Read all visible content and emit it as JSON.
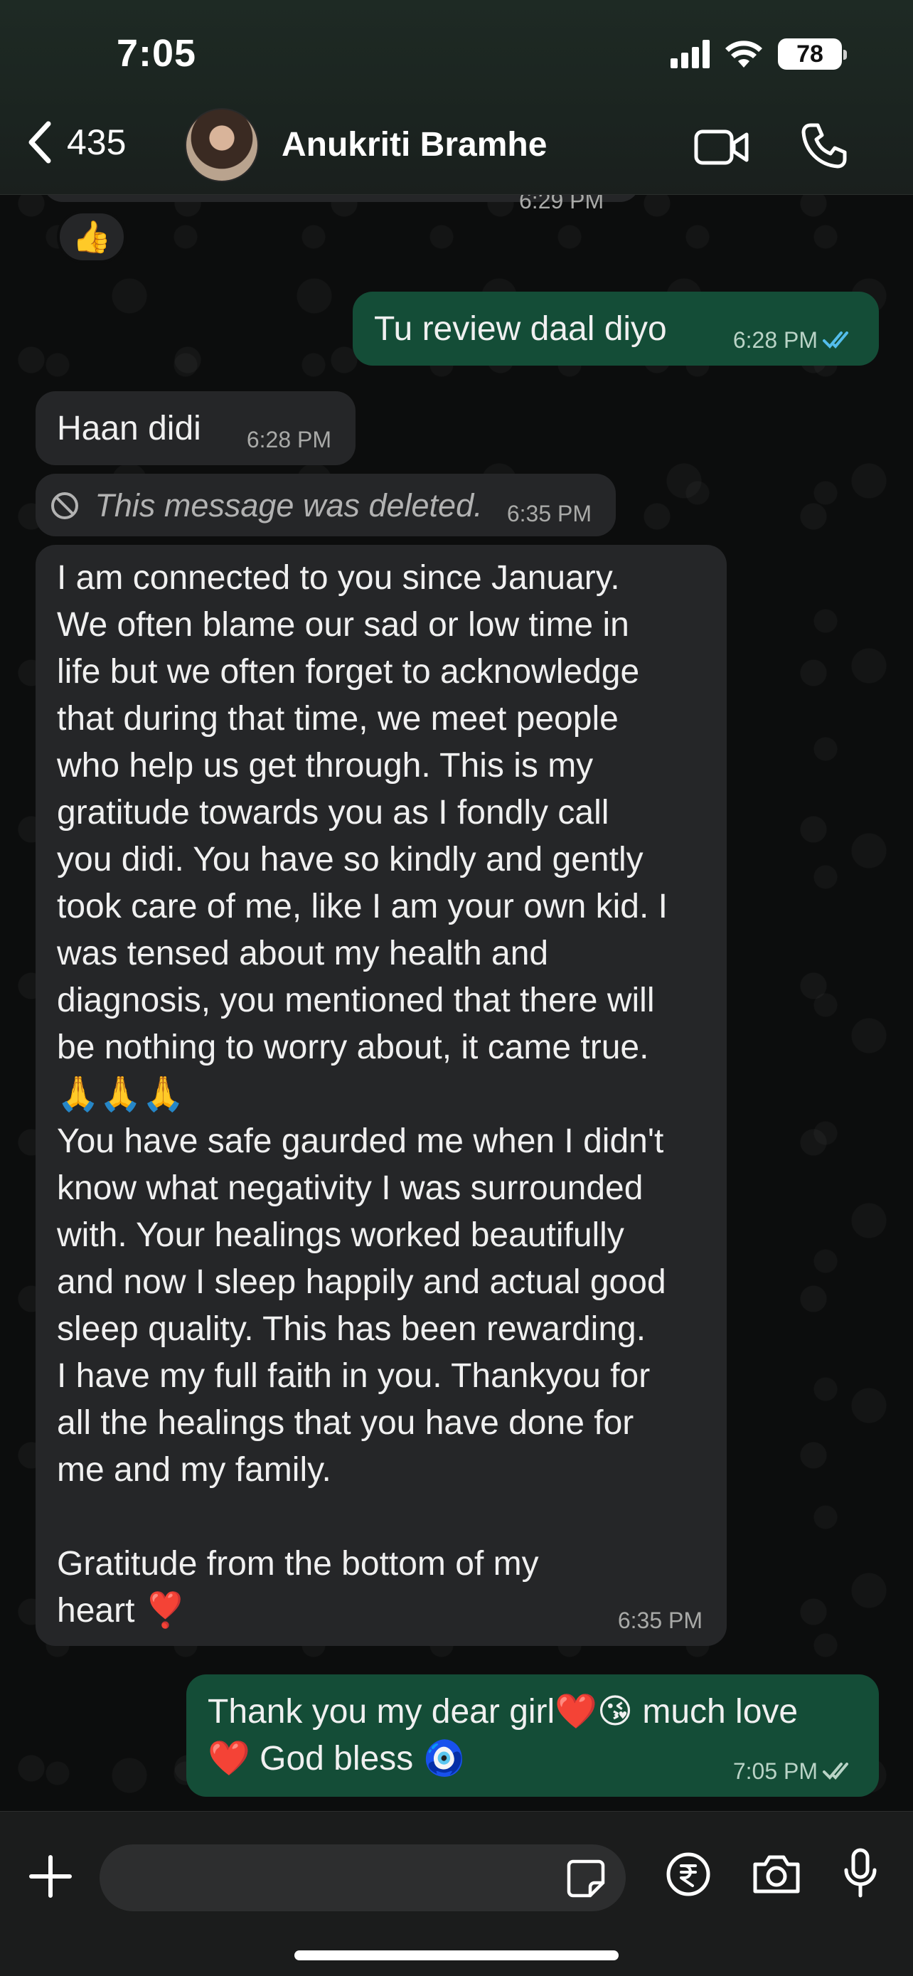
{
  "status_bar": {
    "time": "7:05",
    "battery": "78"
  },
  "header": {
    "back_count": "435",
    "contact_name": "Anukriti Bramhe"
  },
  "messages": {
    "prev_time": "6:29 PM",
    "reaction": "👍",
    "m1": {
      "text": "Tu review daal  diyo",
      "time": "6:28 PM"
    },
    "m2": {
      "text": "Haan didi",
      "time": "6:28 PM"
    },
    "m3": {
      "text": "This message was deleted.",
      "time": "6:35 PM"
    },
    "m4": {
      "text": "I am connected to you since January.\nWe often blame our sad or low time in\nlife but we often forget to acknowledge\nthat during that time, we meet people\nwho help us get through. This is my\ngratitude towards you as I fondly call\nyou didi. You have so kindly and gently\ntook care of me, like I am your own kid. I\nwas tensed about my health and\ndiagnosis, you mentioned that there will\nbe nothing to worry about, it came true.\n🙏🙏🙏\nYou have safe gaurded me when I didn't\nknow what negativity I was surrounded\nwith. Your healings worked beautifully\nand now I sleep happily and actual good\nsleep quality. This has been rewarding.\nI have my full faith in you. Thankyou for\nall the healings that you have done for\nme and my family.\n\nGratitude from the bottom of my\nheart ❣️",
      "time": "6:35 PM"
    },
    "m5": {
      "text": "Thank you my dear girl❤️😘 much love\n❤️ God bless 🧿",
      "time": "7:05 PM"
    }
  },
  "colors": {
    "incoming": "#252628",
    "outgoing": "#144d37",
    "read_tick": "#53bdeb",
    "header_bg": "#1e2a24"
  },
  "icons": [
    "back-chevron-icon",
    "video-call-icon",
    "phone-call-icon",
    "plus-icon",
    "sticker-icon",
    "rupee-icon",
    "camera-icon",
    "mic-icon"
  ]
}
